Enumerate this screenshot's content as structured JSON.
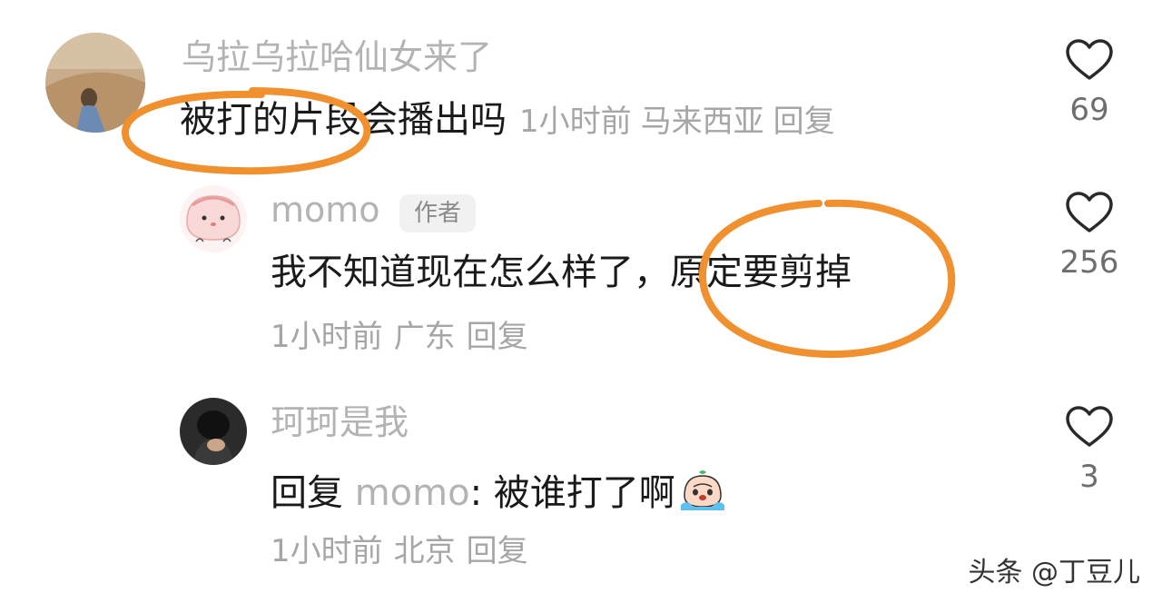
{
  "comments": [
    {
      "username": "乌拉乌拉哈仙女来了",
      "text": "被打的片段会播出吗",
      "time": "1小时前",
      "location": "马来西亚",
      "reply_label": "回复",
      "likes": "69"
    },
    {
      "username": "momo",
      "badge": "作者",
      "text": "我不知道现在怎么样了，原定要剪掉",
      "time": "1小时前",
      "location": "广东",
      "reply_label": "回复",
      "likes": "256"
    },
    {
      "username": "珂珂是我",
      "reply_prefix": "回复",
      "reply_to": "momo",
      "text": ": 被谁打了啊",
      "emoji_icon": "crying-emoji-icon",
      "time": "1小时前",
      "location": "北京",
      "reply_label": "回复",
      "likes": "3"
    }
  ],
  "annotation_color": "#f0902f",
  "watermark": "头条 @丁豆儿"
}
